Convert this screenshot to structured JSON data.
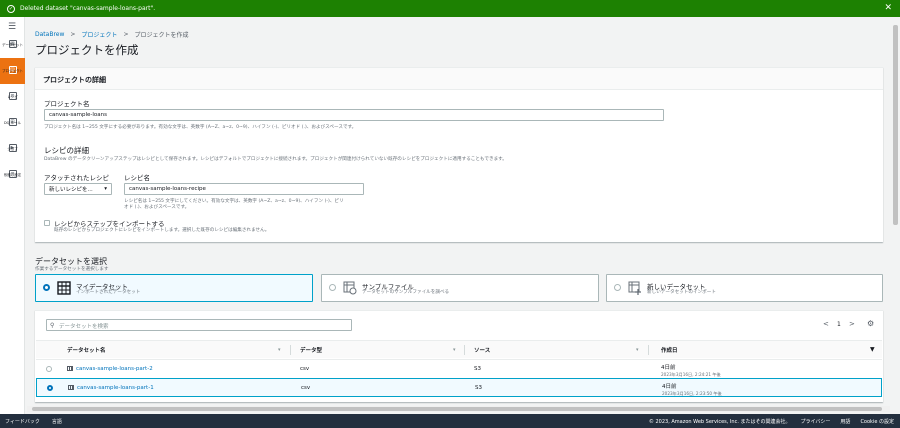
{
  "flash": {
    "message": "Deleted dataset \"canvas-sample-loans-part\".",
    "close": "✕"
  },
  "rail": {
    "items": [
      {
        "label": "データセット"
      },
      {
        "label": "プロジェクト"
      },
      {
        "label": "レシピ"
      },
      {
        "label": "DQ ルール"
      },
      {
        "label": "ジョブ"
      },
      {
        "label": "系譜の設定"
      }
    ]
  },
  "breadcrumb": {
    "root": "DataBrew",
    "projects": "プロジェクト",
    "current": "プロジェクトを作成",
    "sep": ">"
  },
  "page_title": "プロジェクトを作成",
  "details": {
    "header": "プロジェクトの詳細",
    "project_name_label": "プロジェクト名",
    "project_name_value": "canvas-sample-loans",
    "project_name_hint": "プロジェクト名は 1~255 文字にする必要があります。有効な文字は、英数字 (A~Z、a~z、0~9)、ハイフン (-)、ピリオド (.)、およびスペースです。",
    "recipe_header": "レシピの詳細",
    "recipe_desc": "DataBrew のデータクリーンアップステップはレシピとして保存されます。レシピはデフォルトでプロジェクトに接続されます。プロジェクトが関連付けられていない既存のレシピをプロジェクトに適用することもできます。",
    "attached_label": "アタッチされたレシピ",
    "attached_value": "新しいレシピを...",
    "recipe_name_label": "レシピ名",
    "recipe_name_value": "canvas-sample-loans-recipe",
    "recipe_name_hint_1": "レシピ名は 1~255 文字にしてください。有効な文字は、英数字 (A~Z、a~z、0~9)、ハイフン (-)、ピリ",
    "recipe_name_hint_2": "オド (.)、およびスペースです。",
    "import_label": "レシピからステップをインポートする",
    "import_hint": "既存のレシピからプロジェクトにレシピをインポートします。選択した既存のレシピは編集されません。"
  },
  "dataset_select": {
    "title": "データセットを選択",
    "subtitle": "作業するデータセットを選択します",
    "tiles": [
      {
        "title": "マイデータセット",
        "sub": "インポートされたデータセット"
      },
      {
        "title": "サンプルファイル",
        "sub": "データセットのサンプルファイルを調べる"
      },
      {
        "title": "新しいデータセット",
        "sub": "新しいデータセットのインポート"
      }
    ]
  },
  "table": {
    "search_placeholder": "データセットを検索",
    "page": "1",
    "prev": "<",
    "next": ">",
    "columns": [
      "データセット名",
      "データ型",
      "ソース",
      "作成日"
    ],
    "rows": [
      {
        "name": "canvas-sample-loans-part-2",
        "type": "csv",
        "source": "S3",
        "created": "4日前",
        "created_sub": "2023年3月16日, 2:24:21 午後"
      },
      {
        "name": "canvas-sample-loans-part-1",
        "type": "csv",
        "source": "S3",
        "created": "4日前",
        "created_sub": "2023年3月16日, 2:23:50 午後"
      }
    ]
  },
  "footer": {
    "feedback": "フィードバック",
    "language": "言語",
    "copyright": "© 2023, Amazon Web Services, Inc. またはその関連会社。",
    "privacy": "プライバシー",
    "terms": "用語",
    "cookie": "Cookie の設定"
  },
  "colors": {
    "accent": "#ec7211",
    "link": "#0073bb",
    "success": "#1d8102",
    "footer_bg": "#232f3e"
  }
}
